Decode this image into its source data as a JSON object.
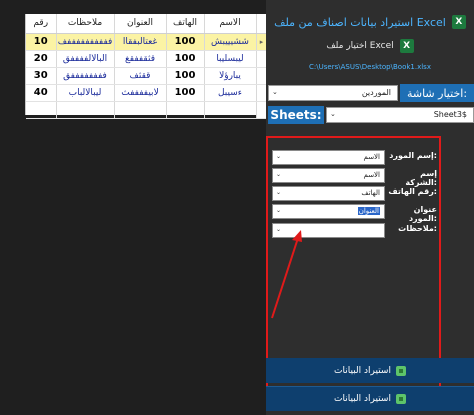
{
  "grid": {
    "columns": [
      "رقم",
      "ملاحظات",
      "العنوان",
      "الهاتف",
      "الاسم"
    ],
    "rows": [
      {
        "num": "10",
        "notes": "ففففففففففف",
        "address": "غعتالبفقاا",
        "phone": "100",
        "name": "ششيييبش"
      },
      {
        "num": "20",
        "notes": "البالالففففق",
        "address": "قثقففقغ",
        "phone": "100",
        "name": "ليبسليبا"
      },
      {
        "num": "30",
        "notes": "ففففففففق",
        "address": "ققثف",
        "phone": "100",
        "name": "يبارؤلا"
      },
      {
        "num": "40",
        "notes": "ليبالالباب",
        "address": "لابيففففث",
        "phone": "100",
        "name": "ءسيبل"
      }
    ]
  },
  "panel": {
    "title": "استيراد بيانات اصناف من ملف Excel",
    "choose_file": "اختيار ملف Excel",
    "file_path": "C:\\Users\\ASUS\\Desktop\\Book1.xlsx",
    "sheet_label": "اختيار شاشة:",
    "sheet_value": "الموردين",
    "sheets_label": "Sheets:",
    "sheets_value": "Sheet3$"
  },
  "mapping": [
    {
      "label": "إسم المورد:",
      "value": "الاسم",
      "highlighted": false
    },
    {
      "label": "إسم الشركة:",
      "value": "الاسم",
      "highlighted": false
    },
    {
      "label": "رقم الهاتف:",
      "value": "الهاتف",
      "highlighted": false
    },
    {
      "label": "عنوان المورد:",
      "value": "العنوان",
      "highlighted": true
    },
    {
      "label": "ملاحظات:",
      "value": "",
      "highlighted": false
    }
  ],
  "buttons": {
    "import1": "استيراد البيانات",
    "import2": "استيراد البيانات"
  },
  "colors": {
    "accent_blue": "#1e6fb5",
    "title_blue": "#4cb5ff",
    "highlight_row": "#fbf3a4",
    "red_frame": "#e01a1a",
    "button_bg": "#0e3f6e"
  },
  "icons": [
    "excel-icon",
    "chevron-down-icon",
    "database-icon",
    "row-pointer-icon"
  ]
}
